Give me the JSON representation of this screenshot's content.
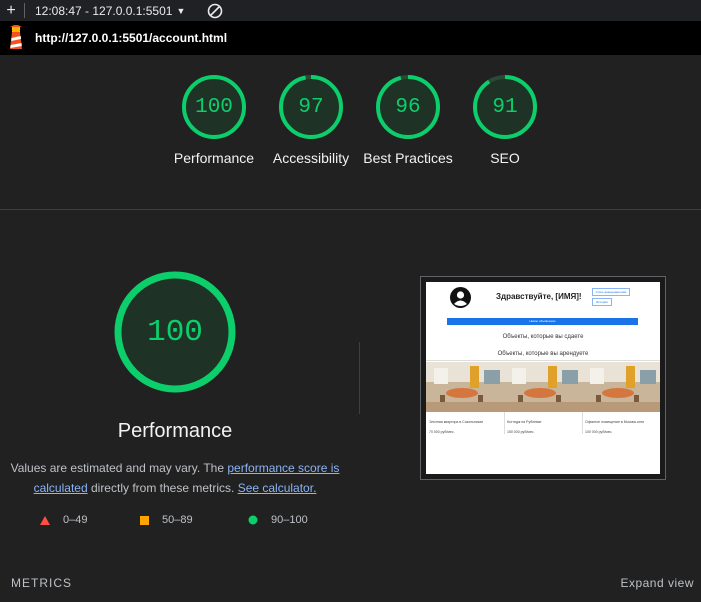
{
  "toolbar": {
    "report_label": "12:08:47 - 127.0.0.1:5501"
  },
  "urlbar": {
    "url": "http://127.0.0.1:5501/account.html"
  },
  "categories": [
    {
      "score": "100",
      "label": "Performance"
    },
    {
      "score": "97",
      "label": "Accessibility"
    },
    {
      "score": "96",
      "label": "Best Practices"
    },
    {
      "score": "91",
      "label": "SEO"
    }
  ],
  "performance": {
    "score": "100",
    "title": "Performance",
    "desc_1": "Values are estimated and may vary. The ",
    "desc_link_1": "performance score is calculated",
    "desc_2": " directly from these metrics. ",
    "desc_link_2": "See calculator."
  },
  "legend": [
    {
      "range": "0–49",
      "color": "#ff4e42"
    },
    {
      "range": "50–89",
      "color": "#ffa400"
    },
    {
      "range": "90–100",
      "color": "#0cce6b"
    }
  ],
  "screenshot": {
    "greeting": "Здравствуйте, [ИМЯ]!",
    "button_1": "Стать арендодателем",
    "button_2": "История",
    "main_button": "Новое объявление",
    "heading_1": "Объекты, которые вы сдаете",
    "heading_2": "Объекты, которые вы арендуете",
    "cards": [
      {
        "name": "Элитная квартира в Сокольниках",
        "price": "70 000 руб/мес."
      },
      {
        "name": "Коттедж на Рублевке",
        "price": "150 000 руб/мес."
      },
      {
        "name": "Офисное помещение в Москва-сити",
        "price": "100 000 руб/мес."
      }
    ]
  },
  "footer": {
    "metrics_label": "METRICS",
    "expand_label": "Expand view"
  },
  "colors": {
    "pass": "#0cce6b",
    "background": "#212121"
  }
}
